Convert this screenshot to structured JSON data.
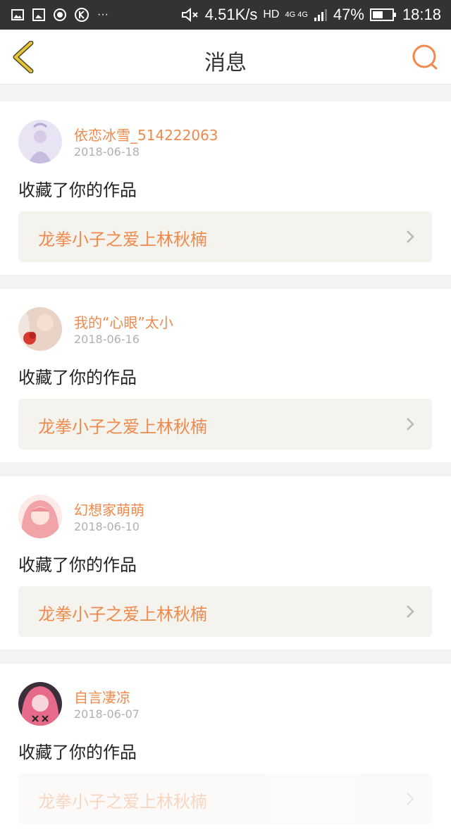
{
  "status_bar": {
    "net_speed": "4.51K/s",
    "hd": "HD",
    "network": "4G 4G",
    "battery": "47%",
    "time": "18:18"
  },
  "header": {
    "title": "消息"
  },
  "messages": [
    {
      "user": "依恋冰雪_514222063",
      "date": "2018-06-18",
      "action": "收藏了你的作品",
      "work": "龙拳小子之爱上林秋楠"
    },
    {
      "user": "我的“心眼”太小",
      "date": "2018-06-16",
      "action": "收藏了你的作品",
      "work": "龙拳小子之爱上林秋楠"
    },
    {
      "user": "幻想家萌萌",
      "date": "2018-06-10",
      "action": "收藏了你的作品",
      "work": "龙拳小子之爱上林秋楠"
    },
    {
      "user": "自言凄凉",
      "date": "2018-06-07",
      "action": "收藏了你的作品",
      "work": "龙拳小子之爱上林秋楠"
    }
  ],
  "colors": {
    "accent": "#ef8a4c",
    "back": "#e8c33a",
    "statusbar": "#333333"
  }
}
